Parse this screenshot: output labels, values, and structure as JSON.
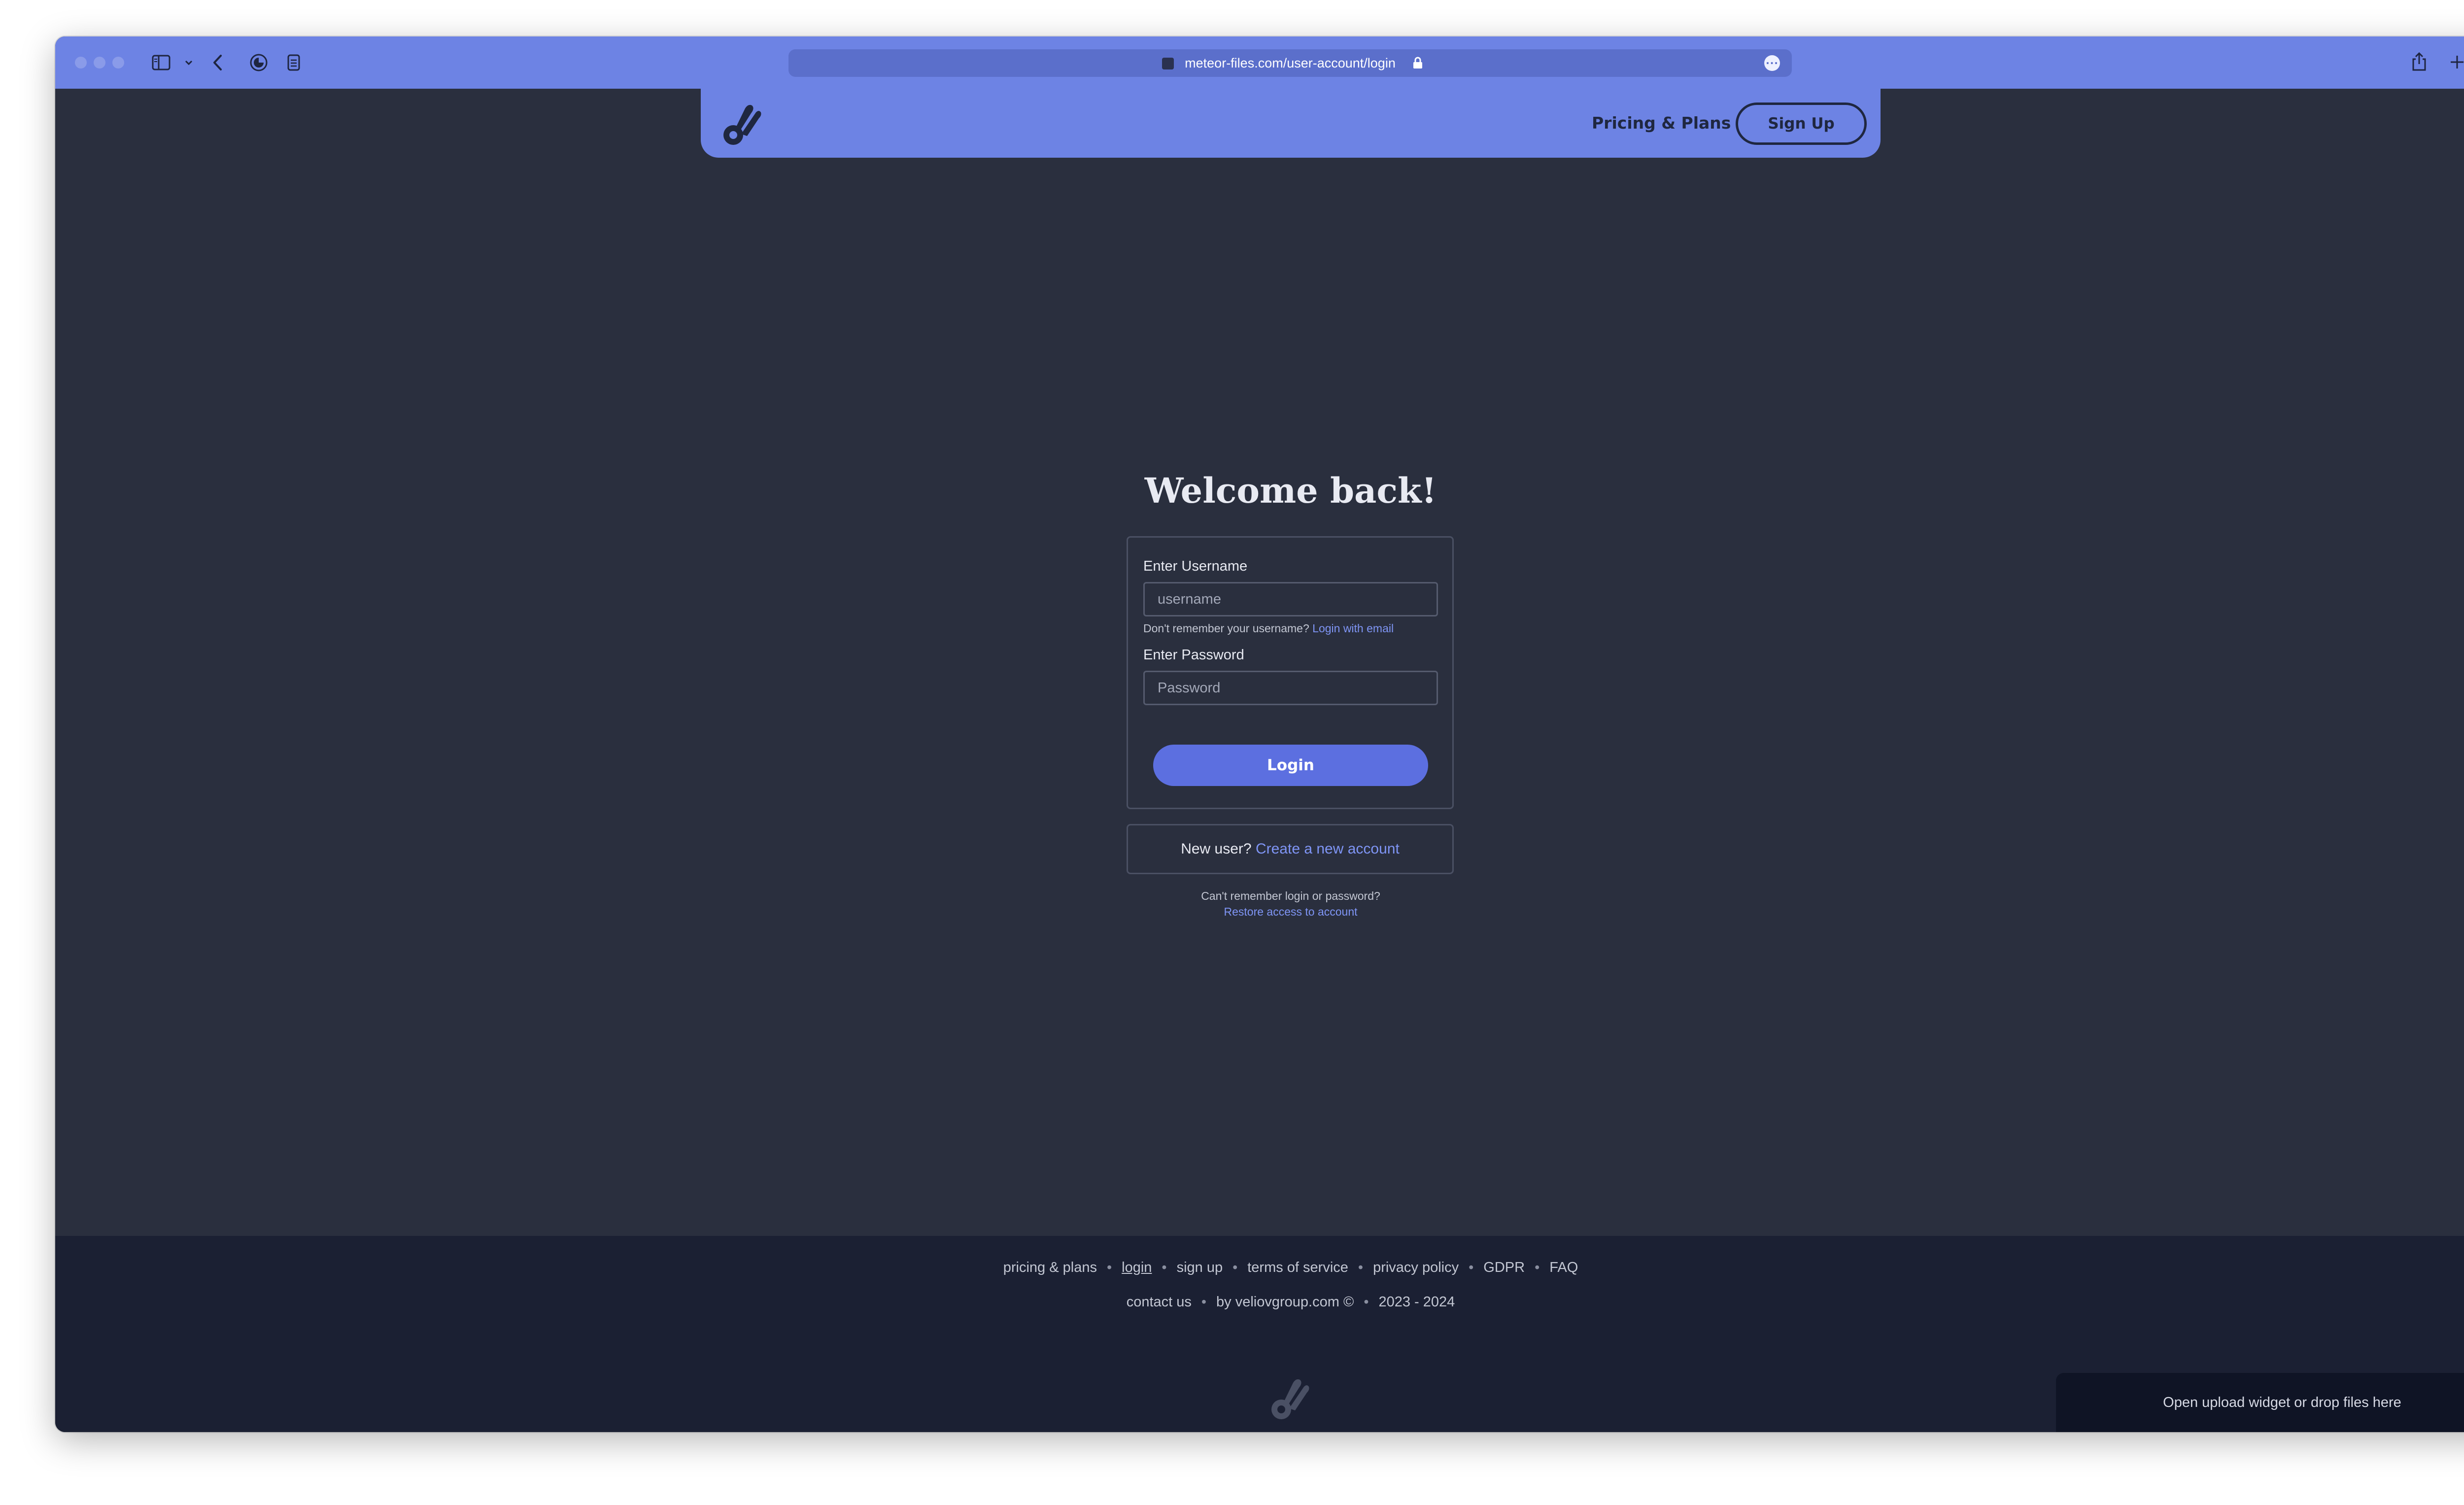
{
  "browser": {
    "url": "meteor-files.com/user-account/login",
    "more_icon": "ellipsis-icon"
  },
  "header": {
    "logo_icon": "meteor-logo-icon",
    "nav_pricing": "Pricing & Plans",
    "nav_signup": "Sign Up"
  },
  "login": {
    "title": "Welcome back!",
    "username_label": "Enter Username",
    "username_placeholder": "username",
    "username_hint": "Don't remember your username?",
    "username_hint_link": "Login with email",
    "password_label": "Enter Password",
    "password_placeholder": "Password",
    "submit_label": "Login",
    "new_user_text": "New user?",
    "new_user_link": "Create a new account",
    "forgot_text": "Can't remember login or password?",
    "forgot_link": "Restore access to account"
  },
  "footer": {
    "links": {
      "pricing": "pricing & plans",
      "login": "login",
      "signup": "sign up",
      "terms": "terms of service",
      "privacy": "privacy policy",
      "gdpr": "GDPR",
      "faq": "FAQ",
      "contact": "contact us",
      "by": "by veliovgroup.com ©",
      "years": "2023 - 2024"
    },
    "separator": "•"
  },
  "upload_widget": {
    "label": "Open upload widget or drop files here"
  },
  "colors": {
    "accent": "#6d83e4",
    "page_bg": "#2a2f3e",
    "footer_bg": "#1b2033",
    "button": "#5c6fe0",
    "link": "#7f95f5"
  }
}
